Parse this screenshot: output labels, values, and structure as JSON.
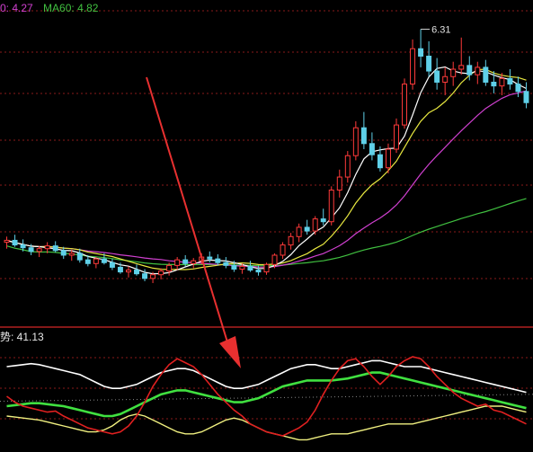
{
  "colors": {
    "background": "#000000",
    "grid": "#8a1a1a",
    "panel_border": "#b02020",
    "candle_up": "#ff3a3a",
    "candle_down": "#5fd0e8",
    "ma_short": "#ffffff",
    "ma_mid": "#e8e840",
    "ma_30": "#d040d0",
    "ma_60": "#40c040",
    "osc_red": "#e02020",
    "osc_white": "#ffffff",
    "osc_green": "#40e040",
    "osc_yellow": "#f0f080",
    "arrow": "#e83030"
  },
  "top_legend": {
    "ma30_label": "0: 4.27",
    "ma60_label": "MA60: 4.82"
  },
  "bottom_legend": {
    "label": "势: 41.13"
  },
  "chart_data": [
    {
      "type": "candlestick",
      "title": "",
      "peak_label": "6.31",
      "ylim": [
        3.3,
        6.45
      ],
      "candles": [
        [
          4.02,
          4.08,
          3.95,
          4.04
        ],
        [
          4.04,
          4.1,
          3.97,
          3.99
        ],
        [
          3.99,
          4.05,
          3.92,
          3.96
        ],
        [
          3.96,
          4.0,
          3.88,
          3.92
        ],
        [
          3.92,
          3.98,
          3.86,
          3.95
        ],
        [
          3.95,
          4.02,
          3.9,
          3.98
        ],
        [
          3.98,
          4.03,
          3.91,
          3.93
        ],
        [
          3.93,
          3.97,
          3.84,
          3.88
        ],
        [
          3.88,
          3.94,
          3.82,
          3.9
        ],
        [
          3.9,
          3.95,
          3.8,
          3.83
        ],
        [
          3.83,
          3.88,
          3.76,
          3.79
        ],
        [
          3.79,
          3.86,
          3.74,
          3.84
        ],
        [
          3.84,
          3.9,
          3.78,
          3.8
        ],
        [
          3.8,
          3.84,
          3.72,
          3.75
        ],
        [
          3.75,
          3.8,
          3.68,
          3.7
        ],
        [
          3.7,
          3.76,
          3.64,
          3.72
        ],
        [
          3.72,
          3.78,
          3.66,
          3.68
        ],
        [
          3.68,
          3.73,
          3.6,
          3.63
        ],
        [
          3.63,
          3.7,
          3.58,
          3.67
        ],
        [
          3.67,
          3.74,
          3.62,
          3.71
        ],
        [
          3.71,
          3.8,
          3.66,
          3.77
        ],
        [
          3.77,
          3.86,
          3.72,
          3.83
        ],
        [
          3.83,
          3.88,
          3.76,
          3.79
        ],
        [
          3.79,
          3.85,
          3.74,
          3.82
        ],
        [
          3.82,
          3.9,
          3.78,
          3.86
        ],
        [
          3.86,
          3.92,
          3.8,
          3.84
        ],
        [
          3.84,
          3.89,
          3.77,
          3.8
        ],
        [
          3.8,
          3.86,
          3.74,
          3.77
        ],
        [
          3.77,
          3.82,
          3.7,
          3.73
        ],
        [
          3.73,
          3.79,
          3.68,
          3.76
        ],
        [
          3.76,
          3.82,
          3.7,
          3.72
        ],
        [
          3.72,
          3.77,
          3.66,
          3.7
        ],
        [
          3.7,
          3.8,
          3.67,
          3.78
        ],
        [
          3.78,
          3.9,
          3.74,
          3.88
        ],
        [
          3.88,
          4.02,
          3.84,
          3.99
        ],
        [
          3.99,
          4.12,
          3.94,
          4.08
        ],
        [
          4.08,
          4.22,
          4.02,
          4.18
        ],
        [
          4.18,
          4.26,
          4.1,
          4.14
        ],
        [
          4.14,
          4.3,
          4.1,
          4.27
        ],
        [
          4.27,
          4.38,
          4.2,
          4.24
        ],
        [
          4.24,
          4.62,
          4.2,
          4.58
        ],
        [
          4.58,
          4.8,
          4.5,
          4.72
        ],
        [
          4.72,
          5.0,
          4.66,
          4.95
        ],
        [
          4.95,
          5.32,
          4.9,
          5.25
        ],
        [
          5.25,
          5.42,
          5.02,
          5.08
        ],
        [
          5.08,
          5.2,
          4.9,
          4.96
        ],
        [
          4.96,
          5.05,
          4.78,
          4.82
        ],
        [
          4.82,
          5.08,
          4.76,
          5.02
        ],
        [
          5.02,
          5.35,
          4.98,
          5.28
        ],
        [
          5.28,
          5.78,
          5.24,
          5.72
        ],
        [
          5.72,
          6.2,
          5.66,
          6.1
        ],
        [
          6.1,
          6.31,
          5.9,
          6.02
        ],
        [
          6.02,
          6.18,
          5.8,
          5.86
        ],
        [
          5.86,
          6.0,
          5.66,
          5.74
        ],
        [
          5.74,
          5.9,
          5.6,
          5.8
        ],
        [
          5.8,
          5.96,
          5.7,
          5.88
        ],
        [
          5.88,
          6.22,
          5.82,
          5.92
        ],
        [
          5.92,
          6.02,
          5.76,
          5.82
        ],
        [
          5.82,
          5.96,
          5.72,
          5.9
        ],
        [
          5.9,
          5.98,
          5.7,
          5.74
        ],
        [
          5.74,
          5.86,
          5.62,
          5.7
        ],
        [
          5.7,
          5.84,
          5.6,
          5.78
        ],
        [
          5.78,
          5.88,
          5.66,
          5.72
        ],
        [
          5.72,
          5.8,
          5.58,
          5.64
        ],
        [
          5.64,
          5.74,
          5.46,
          5.52
        ]
      ]
    },
    {
      "type": "line",
      "title": "",
      "ylim": [
        0,
        100
      ],
      "series": [
        {
          "values": [
            50,
            44,
            40,
            38,
            36,
            34,
            35,
            30,
            26,
            22,
            18,
            16,
            14,
            12,
            14,
            20,
            30,
            44,
            60,
            72,
            82,
            88,
            84,
            80,
            72,
            62,
            52,
            44,
            36,
            30,
            22,
            18,
            14,
            12,
            10,
            14,
            18,
            24,
            36,
            52,
            66,
            78,
            86,
            88,
            80,
            70,
            62,
            70,
            80,
            86,
            90,
            88,
            80,
            70,
            62,
            54,
            48,
            44,
            40,
            42,
            36,
            34,
            30,
            26,
            22
          ]
        },
        {
          "values": [
            80,
            81,
            82,
            83,
            82,
            80,
            78,
            76,
            74,
            72,
            68,
            64,
            60,
            58,
            58,
            60,
            62,
            66,
            70,
            74,
            76,
            78,
            78,
            76,
            72,
            68,
            64,
            60,
            58,
            58,
            60,
            62,
            66,
            70,
            74,
            78,
            80,
            82,
            82,
            80,
            78,
            78,
            80,
            82,
            84,
            86,
            86,
            84,
            82,
            80,
            80,
            80,
            78,
            76,
            74,
            72,
            70,
            68,
            66,
            64,
            62,
            60,
            58,
            56,
            54
          ]
        },
        {
          "values": [
            40,
            41,
            42,
            43,
            43,
            42,
            41,
            40,
            38,
            36,
            34,
            32,
            30,
            30,
            32,
            36,
            40,
            44,
            48,
            52,
            54,
            56,
            56,
            54,
            52,
            50,
            48,
            46,
            44,
            44,
            46,
            48,
            52,
            56,
            60,
            62,
            64,
            66,
            66,
            66,
            66,
            67,
            68,
            70,
            72,
            74,
            74,
            72,
            70,
            68,
            66,
            64,
            62,
            60,
            58,
            56,
            54,
            52,
            50,
            48,
            46,
            44,
            42,
            40,
            38
          ]
        },
        {
          "values": [
            30,
            29,
            28,
            27,
            26,
            24,
            22,
            20,
            18,
            16,
            14,
            14,
            16,
            20,
            26,
            30,
            32,
            30,
            26,
            22,
            18,
            14,
            12,
            12,
            14,
            18,
            22,
            26,
            28,
            26,
            22,
            18,
            14,
            12,
            10,
            8,
            6,
            6,
            8,
            10,
            12,
            12,
            12,
            14,
            16,
            18,
            20,
            22,
            22,
            22,
            22,
            24,
            26,
            28,
            30,
            32,
            34,
            36,
            38,
            40,
            40,
            40,
            38,
            36,
            34
          ]
        }
      ]
    }
  ]
}
